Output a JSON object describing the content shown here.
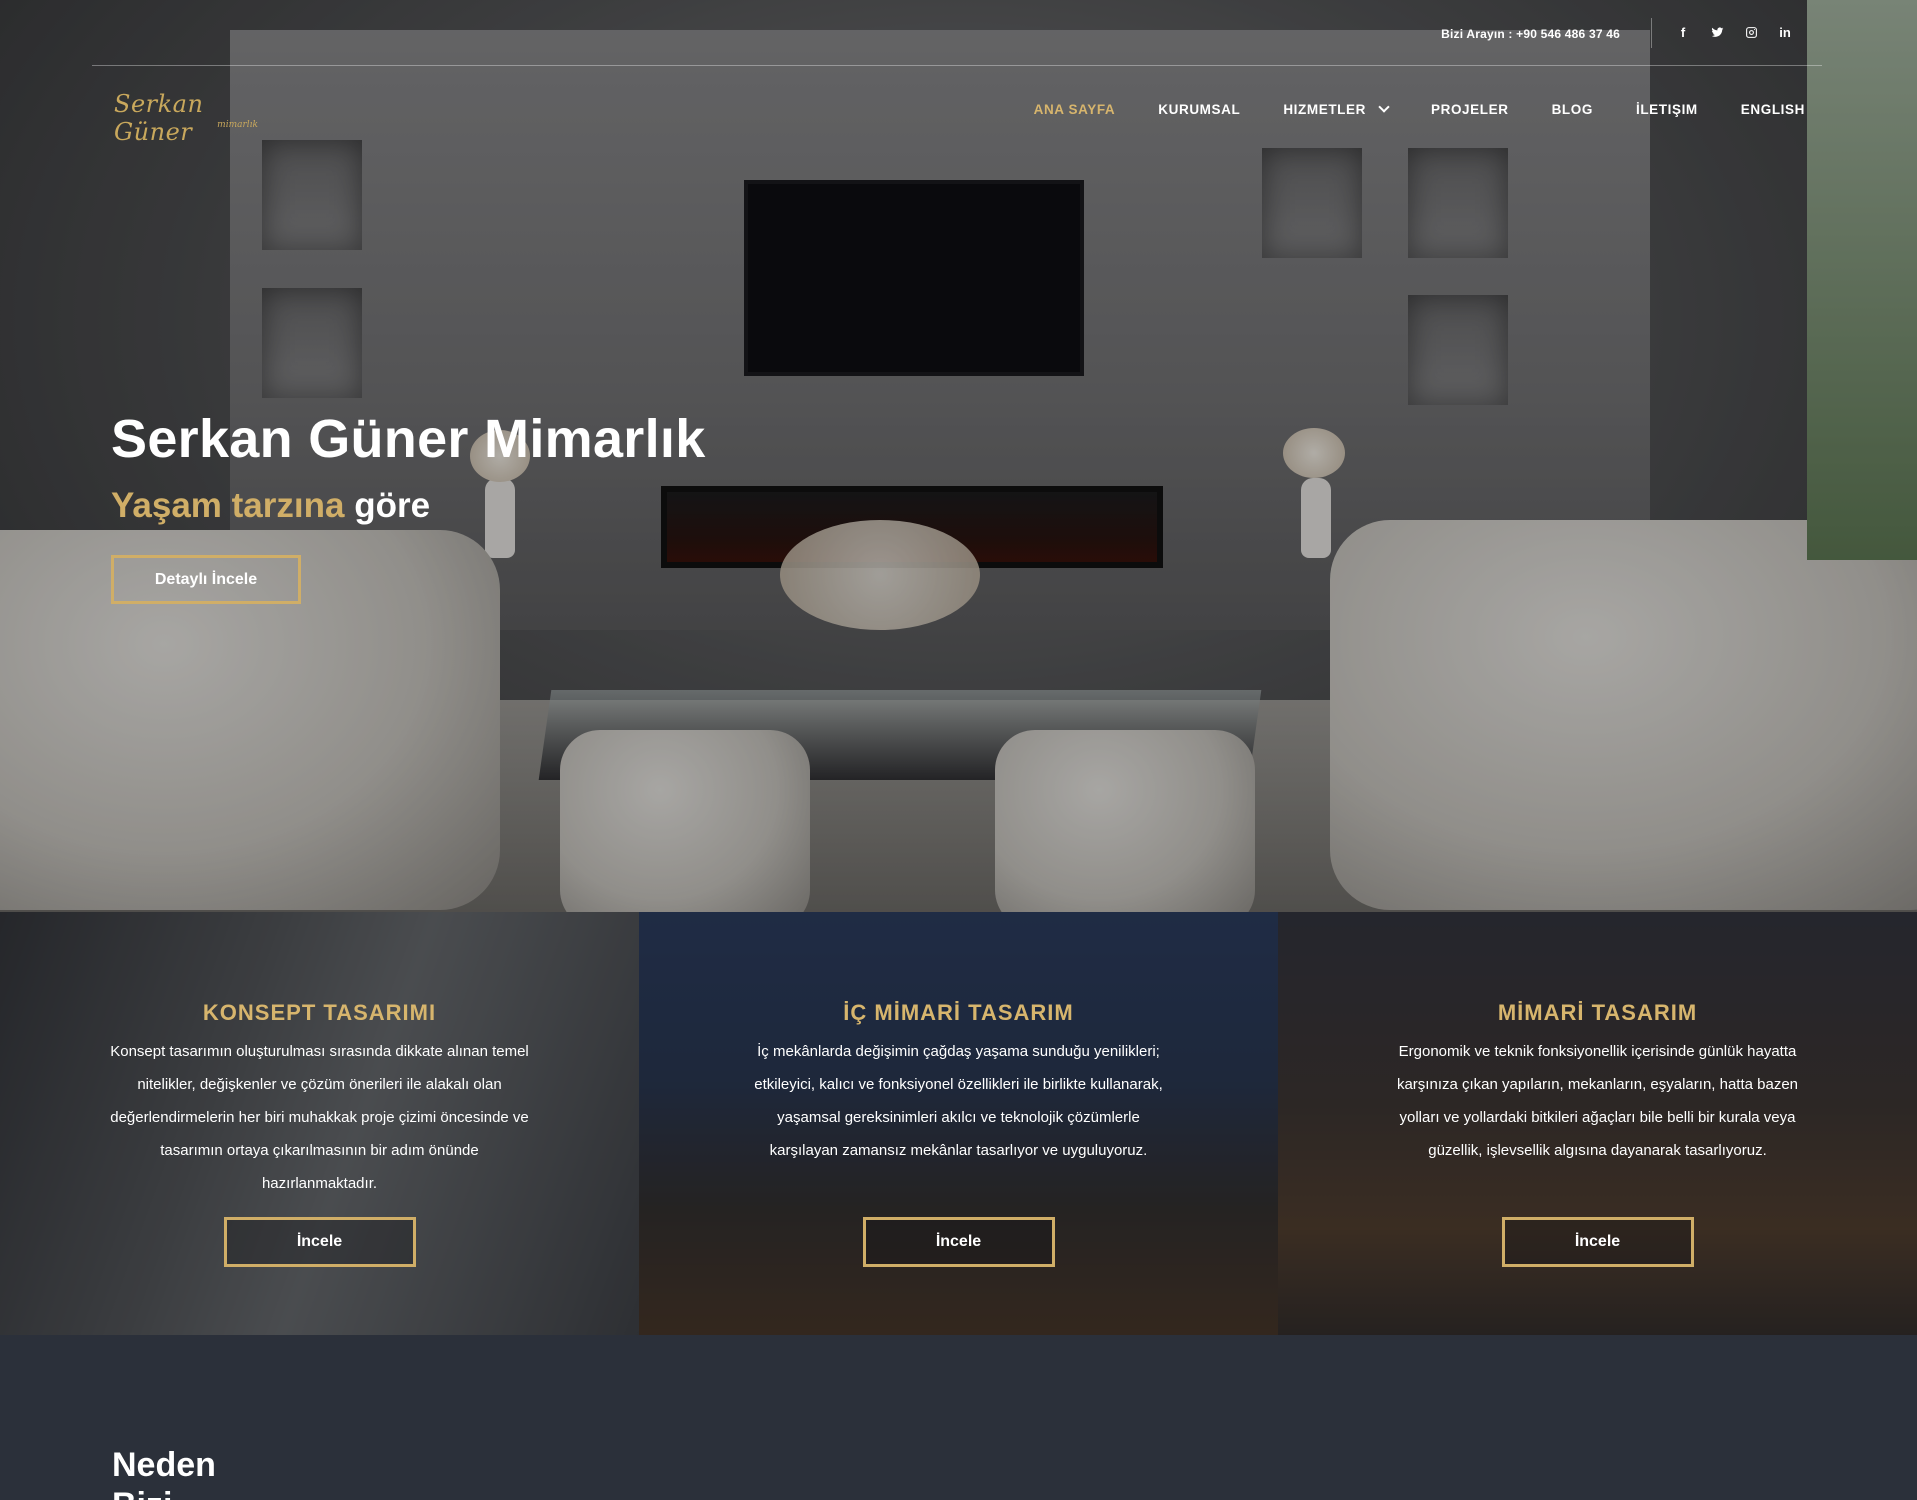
{
  "topbar": {
    "phone": "Bizi Arayın : +90 546 486 37 46",
    "social_icons": [
      "facebook-icon",
      "twitter-icon",
      "instagram-icon",
      "linkedin-icon"
    ]
  },
  "logo": {
    "script": "Serkan Güner",
    "sub": "mimarlık"
  },
  "nav": {
    "items": [
      {
        "label": "ANA SAYFA",
        "active": true
      },
      {
        "label": "KURUMSAL"
      },
      {
        "label": "HIZMETLER",
        "has_dropdown": true
      },
      {
        "label": "PROJELER"
      },
      {
        "label": "BLOG"
      },
      {
        "label": "İLETIŞIM"
      },
      {
        "label": "ENGLISH"
      }
    ]
  },
  "hero": {
    "title": "Serkan Güner Mimarlık",
    "subtitle_gold": "Yaşam tarzına",
    "subtitle_white": "göre",
    "button": "Detaylı İncele"
  },
  "services": [
    {
      "title": "KONSEPT TASARIMI",
      "text": "Konsept tasarımın oluşturulması sırasında dikkate alınan temel nitelikler, değişkenler ve çözüm önerileri ile alakalı olan değerlendirmelerin her biri muhakkak proje çizimi öncesinde ve tasarımın ortaya çıkarılmasının bir adım önünde hazırlanmaktadır.",
      "button": "İncele"
    },
    {
      "title": "İÇ MİMARİ TASARIM",
      "text": "İç mekânlarda değişimin çağdaş yaşama sunduğu yenilikleri; etkileyici, kalıcı ve fonksiyonel özellikleri ile birlikte kullanarak, yaşamsal gereksinimleri akılcı ve teknolojik çözümlerle karşılayan zamansız mekânlar tasarlıyor ve uyguluyoruz.",
      "button": "İncele"
    },
    {
      "title": "MİMARİ TASARIM",
      "text": "Ergonomik ve teknik fonksiyonellik içerisinde günlük hayatta karşınıza çıkan yapıların, mekanların, eşyaların, hatta bazen yolları ve yollardaki bitkileri ağaçları bile belli bir kurala veya güzellik, işlevsellik algısına dayanarak tasarlıyoruz.",
      "button": "İncele"
    }
  ],
  "bottom": {
    "heading": "Neden Bizi"
  },
  "colors": {
    "gold": "#d0ae67",
    "dark": "#2b303a"
  }
}
